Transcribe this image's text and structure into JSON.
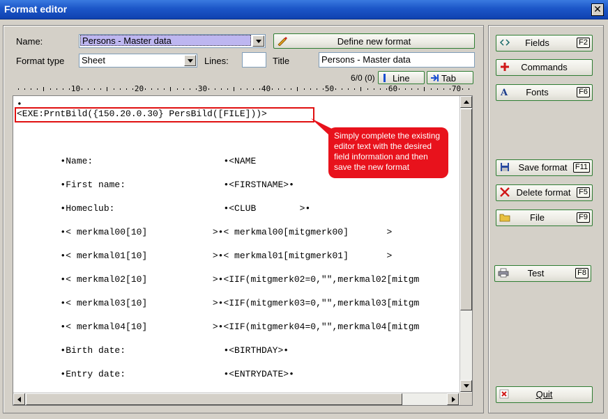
{
  "window": {
    "title": "Format editor",
    "close_glyph": "✕"
  },
  "form": {
    "name_label": "Name:",
    "name_value": "Persons - Master data",
    "format_type_label": "Format type",
    "format_type_value": "Sheet",
    "lines_label": "Lines:",
    "lines_value": "",
    "title_label": "Title",
    "title_value": "Persons - Master data",
    "define_new_format_label": "Define new format",
    "counter": "6/0 (0)",
    "line_btn": "Line",
    "tab_btn": "Tab"
  },
  "ruler": {
    "labels": [
      "10",
      "20",
      "30",
      "40",
      "50",
      "60",
      "70"
    ]
  },
  "editor": {
    "lines": [
      "•",
      "<EXE:PrntBild({150.20.0.30} PersBild([FILE]))>",
      "        •Name:                        •<NAME",
      "        •First name:                  •<FIRSTNAME>•",
      "        •Homeclub:                    •<CLUB        >•",
      "        •< merkmal00[10]            >•< merkmal00[mitgmerk00]       >",
      "        •< merkmal01[10]            >•< merkmal01[mitgmerk01]       >",
      "        •< merkmal02[10]            >•<IIF(mitgmerk02=0,\"\",merkmal02[mitgm",
      "        •< merkmal03[10]            >•<IIF(mitgmerk03=0,\"\",merkmal03[mitgm",
      "        •< merkmal04[10]            >•<IIF(mitgmerk04=0,\"\",merkmal04[mitgm",
      "        •Birth date:                  •<BIRTHDAY>•",
      "        •Entry date:                  •<ENTRYDATE>•"
    ],
    "callout": "Simply complete the existing editor text with the desired field information and then save the new format"
  },
  "sidebar": {
    "fields": {
      "label": "Fields",
      "key": "F2"
    },
    "commands": {
      "label": "Commands"
    },
    "fonts": {
      "label": "Fonts",
      "key": "F6"
    },
    "save_format": {
      "label": "Save format",
      "key": "F11"
    },
    "delete_format": {
      "label": "Delete format",
      "key": "F5"
    },
    "file": {
      "label": "File",
      "key": "F9"
    },
    "test": {
      "label": "Test",
      "key": "F8"
    },
    "quit": {
      "label": "Quit"
    }
  },
  "colors": {
    "accent_border": "#2e7d32",
    "title_bar": "#1c56c8",
    "callout": "#e8121c"
  }
}
